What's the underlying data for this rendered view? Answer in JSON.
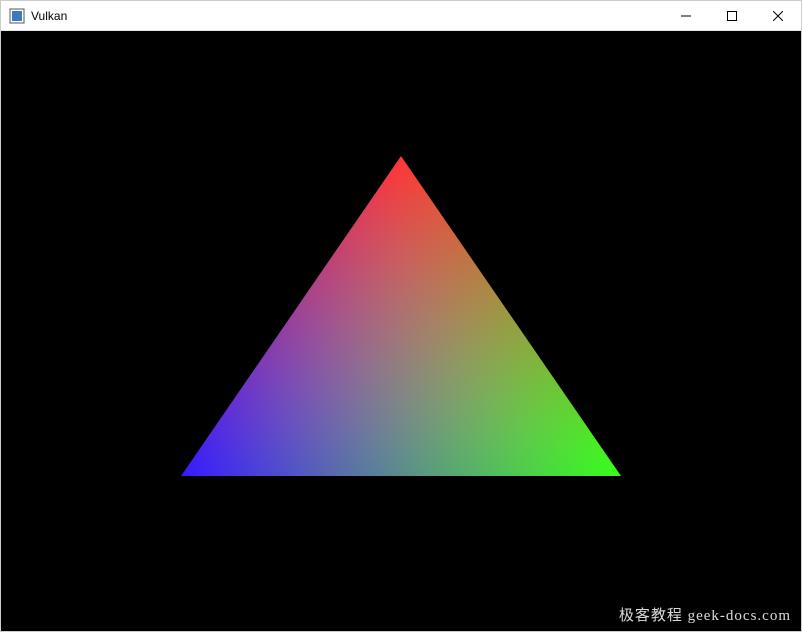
{
  "window": {
    "title": "Vulkan",
    "icon_name": "app-icon"
  },
  "controls": {
    "minimize": "Minimize",
    "maximize": "Maximize",
    "close": "Close"
  },
  "canvas": {
    "background_color": "#000000",
    "triangle": {
      "vertices": [
        {
          "label": "top",
          "color": "#ff0000"
        },
        {
          "label": "bottom-right",
          "color": "#00ff00"
        },
        {
          "label": "bottom-left",
          "color": "#0000ff"
        }
      ]
    }
  },
  "watermark": {
    "text": "极客教程 geek-docs.com"
  }
}
